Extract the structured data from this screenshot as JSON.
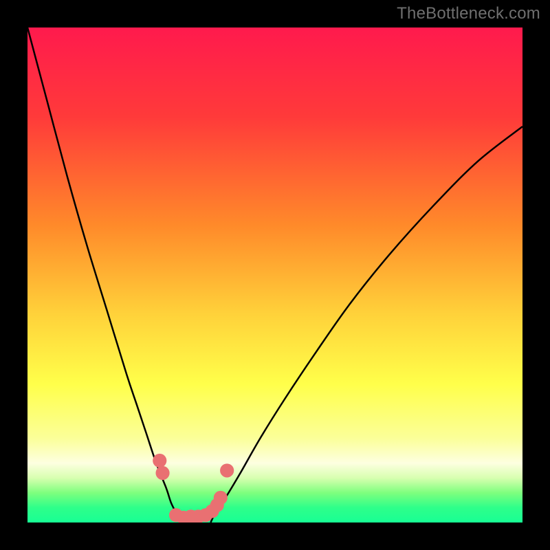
{
  "attribution": "TheBottleneck.com",
  "chart_data": {
    "type": "line",
    "title": "",
    "xlabel": "",
    "ylabel": "",
    "xlim": [
      0,
      100
    ],
    "ylim": [
      0,
      100
    ],
    "gradient_stops": [
      {
        "offset": 0,
        "color": "#ff1a4d"
      },
      {
        "offset": 18,
        "color": "#ff3a3a"
      },
      {
        "offset": 40,
        "color": "#ff8a2a"
      },
      {
        "offset": 58,
        "color": "#ffd23a"
      },
      {
        "offset": 72,
        "color": "#ffff4a"
      },
      {
        "offset": 83,
        "color": "#fbff99"
      },
      {
        "offset": 88,
        "color": "#fdffe0"
      },
      {
        "offset": 91,
        "color": "#d8ffb0"
      },
      {
        "offset": 94,
        "color": "#7eff7e"
      },
      {
        "offset": 97,
        "color": "#2eff8a"
      },
      {
        "offset": 100,
        "color": "#18ff94"
      }
    ],
    "series": [
      {
        "name": "left-curve",
        "x": [
          0,
          4,
          8,
          12,
          16,
          20,
          22,
          24,
          26,
          28,
          29,
          30,
          31
        ],
        "y": [
          100,
          85,
          70,
          56,
          43,
          30,
          24,
          18,
          12,
          7,
          4,
          2,
          0
        ]
      },
      {
        "name": "right-curve",
        "x": [
          37,
          38,
          40,
          43,
          47,
          52,
          58,
          65,
          73,
          82,
          91,
          100
        ],
        "y": [
          0,
          2,
          5,
          10,
          17,
          25,
          34,
          44,
          54,
          64,
          73,
          80
        ]
      }
    ],
    "markers": [
      {
        "x": 26.7,
        "y": 12.5
      },
      {
        "x": 27.3,
        "y": 10.0
      },
      {
        "x": 30.0,
        "y": 1.5
      },
      {
        "x": 31.5,
        "y": 1.0
      },
      {
        "x": 33.0,
        "y": 1.2
      },
      {
        "x": 34.5,
        "y": 1.2
      },
      {
        "x": 36.0,
        "y": 1.5
      },
      {
        "x": 37.3,
        "y": 2.3
      },
      {
        "x": 38.3,
        "y": 3.5
      },
      {
        "x": 39.0,
        "y": 5.0
      },
      {
        "x": 40.3,
        "y": 10.5
      }
    ],
    "marker_color": "#e97072",
    "marker_radius_pct": 1.4
  }
}
